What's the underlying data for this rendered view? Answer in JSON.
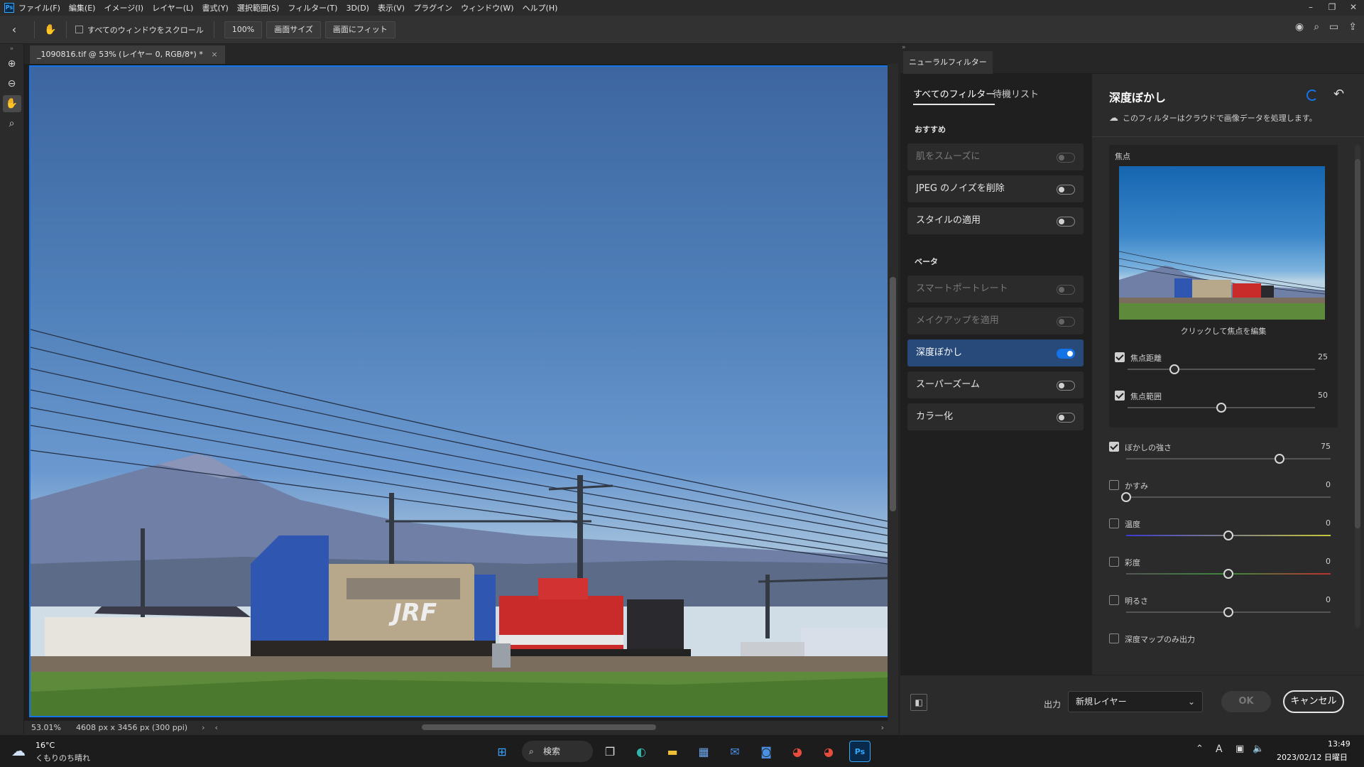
{
  "app": {
    "logo": "Ps"
  },
  "menu": [
    "ファイル(F)",
    "編集(E)",
    "イメージ(I)",
    "レイヤー(L)",
    "書式(Y)",
    "選択範囲(S)",
    "フィルター(T)",
    "3D(D)",
    "表示(V)",
    "プラグイン",
    "ウィンドウ(W)",
    "ヘルプ(H)"
  ],
  "options": {
    "scroll_all_label": "すべてのウィンドウをスクロール",
    "zoom_100": "100%",
    "fit_screen_size": "画面サイズ",
    "fit_screen": "画面にフィット"
  },
  "document": {
    "tab_title": "_1090816.tif @ 53% (レイヤー 0, RGB/8*) *",
    "close": "×",
    "zoom": "53.01%",
    "dims": "4608 px x 3456 px (300 ppi)"
  },
  "neural": {
    "panel_tab": "ニューラルフィルター",
    "tab_all": "すべてのフィルター",
    "tab_wait": "待機リスト",
    "section_recommended": "おすすめ",
    "section_beta": "ベータ",
    "recommended": [
      {
        "label": "肌をスムーズに",
        "enabled": false,
        "dim": true
      },
      {
        "label": "JPEG のノイズを削除",
        "enabled": false,
        "dim": false
      },
      {
        "label": "スタイルの適用",
        "enabled": false,
        "dim": false
      }
    ],
    "beta": [
      {
        "label": "スマートポートレート",
        "enabled": false,
        "dim": true
      },
      {
        "label": "メイクアップを適用",
        "enabled": false,
        "dim": true
      },
      {
        "label": "深度ぼかし",
        "enabled": true,
        "dim": false
      },
      {
        "label": "スーパーズーム",
        "enabled": false,
        "dim": false
      },
      {
        "label": "カラー化",
        "enabled": false,
        "dim": false
      }
    ],
    "detail": {
      "title": "深度ぼかし",
      "cloud_note": "このフィルターはクラウドで画像データを処理します。",
      "focus_label": "焦点",
      "preview_hint": "クリックして焦点を編集",
      "focus_sliders": [
        {
          "label": "焦点距離",
          "value": 25,
          "checked": true
        },
        {
          "label": "焦点範囲",
          "value": 50,
          "checked": true
        }
      ],
      "sliders": [
        {
          "label": "ぼかしの強さ",
          "value": 75,
          "checked": true,
          "pos": 0.75,
          "gradient": "gray"
        },
        {
          "label": "かすみ",
          "value": 0,
          "checked": false,
          "pos": 0.0,
          "gradient": "gray"
        },
        {
          "label": "温度",
          "value": 0,
          "checked": false,
          "pos": 0.5,
          "gradient": "temp"
        },
        {
          "label": "彩度",
          "value": 0,
          "checked": false,
          "pos": 0.5,
          "gradient": "sat"
        },
        {
          "label": "明るさ",
          "value": 0,
          "checked": false,
          "pos": 0.5,
          "gradient": "gray"
        }
      ],
      "depth_only": "深度マップのみ出力"
    },
    "output_label": "出力",
    "output_value": "新規レイヤー",
    "ok": "OK",
    "cancel": "キャンセル"
  },
  "taskbar": {
    "temp": "16°C",
    "weather": "くもりのち晴れ",
    "search": "検索",
    "time": "13:49",
    "date": "2023/02/12 日曜日",
    "ime": "A"
  },
  "colors": {
    "accent": "#1473e6",
    "selected_filter": "#274a7a",
    "panel": "#2b2b2b"
  }
}
